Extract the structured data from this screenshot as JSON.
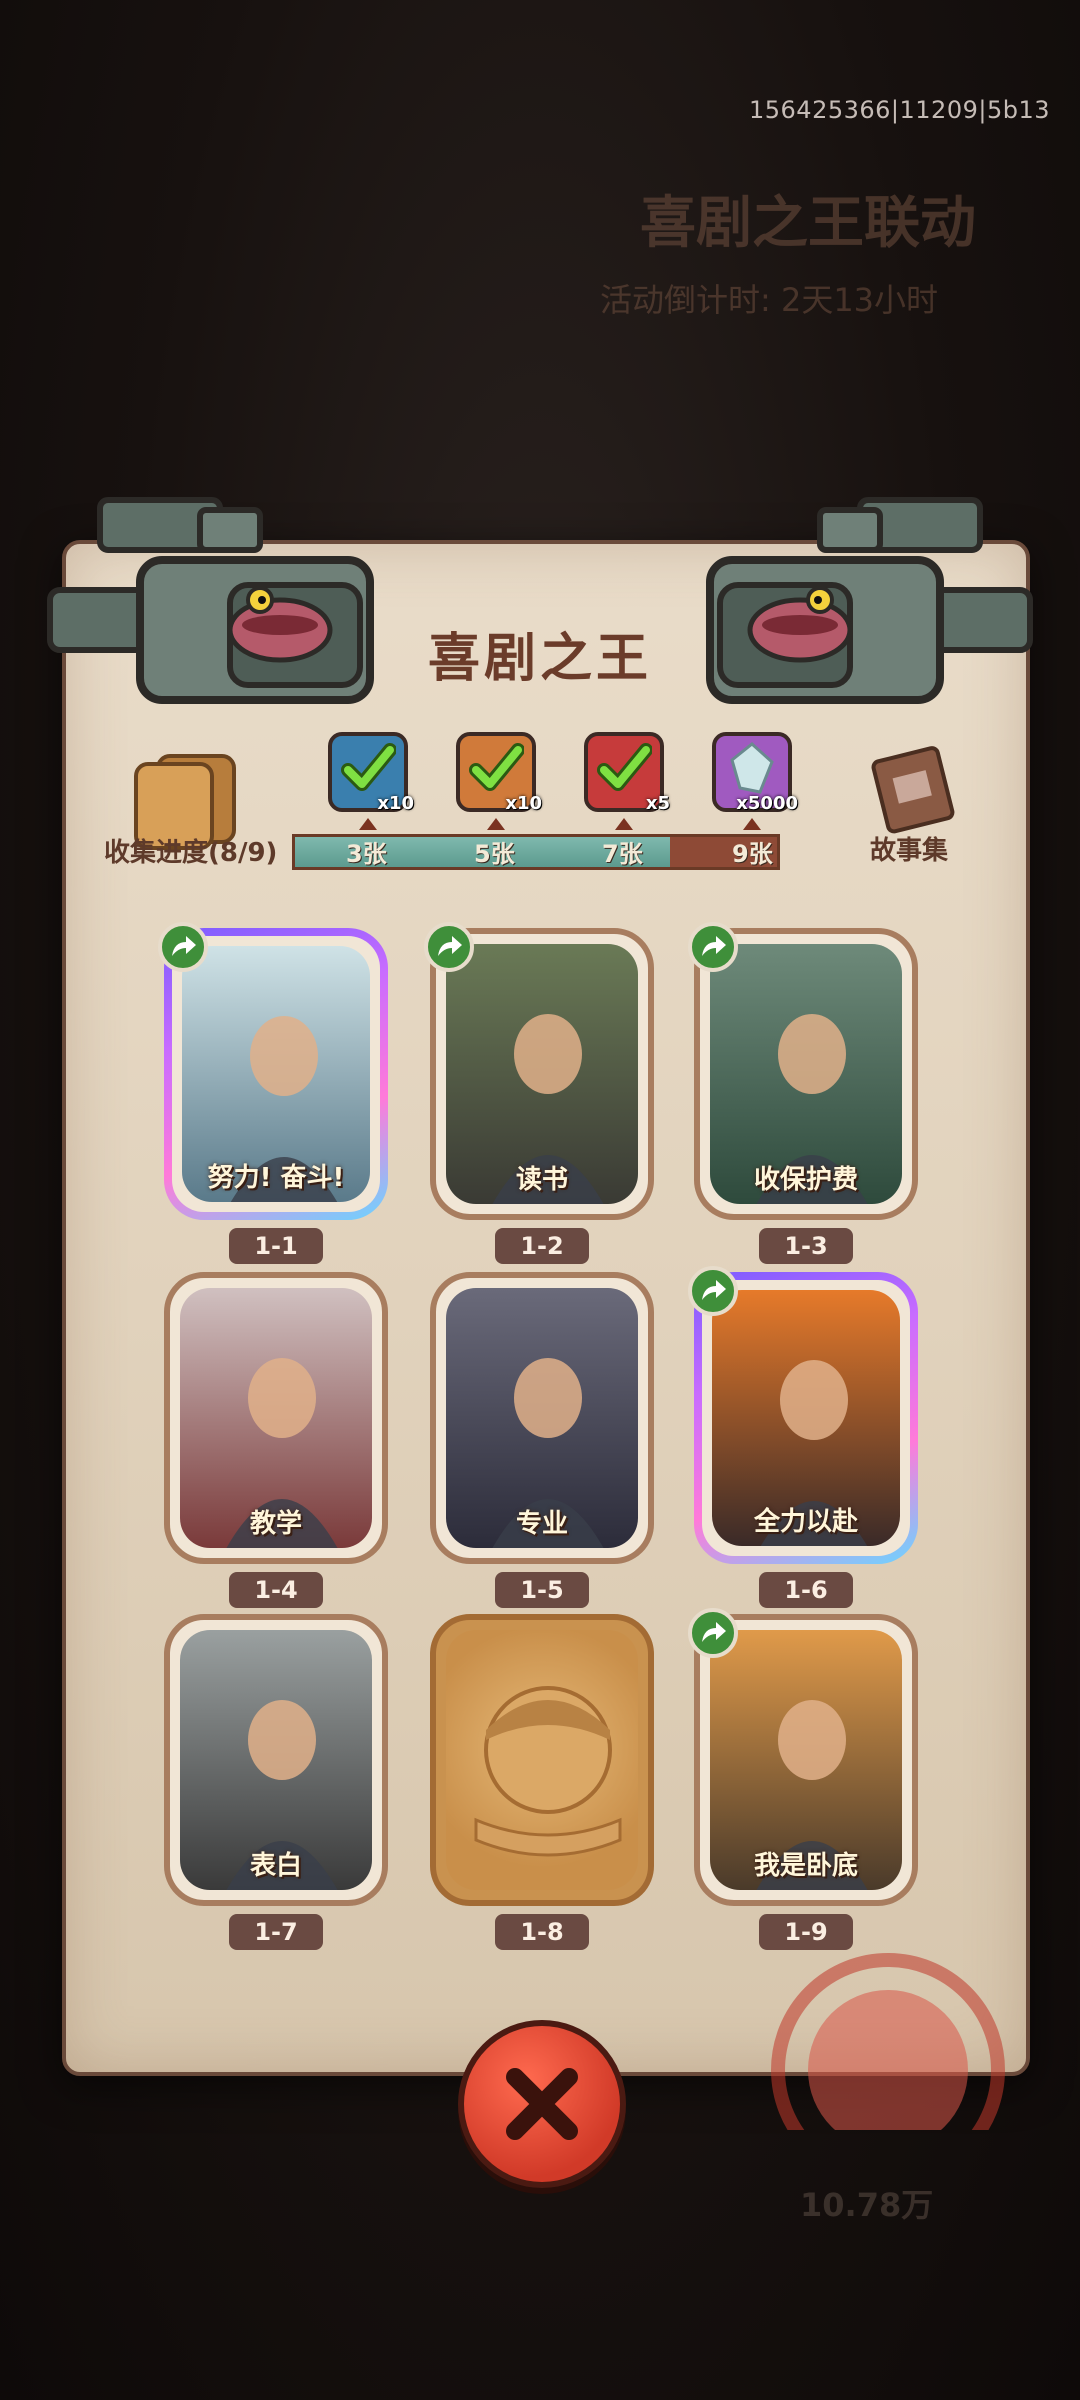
{
  "build_id": "156425366|11209|5b13",
  "background": {
    "event_subtitle": "",
    "event_title": "喜剧之王联动",
    "countdown": "活动倒计时: 2天13小时",
    "currency": "10.78万"
  },
  "panel": {
    "title": "喜剧之王",
    "collect_progress": "收集进度(8/9)",
    "story_label": "故事集"
  },
  "rewards": [
    {
      "multiplier": "x10",
      "icon": "teal-checked-chest-icon",
      "color": "#3a7fae"
    },
    {
      "multiplier": "x10",
      "icon": "orange-checked-chest-icon",
      "color": "#d07a3a"
    },
    {
      "multiplier": "x5",
      "icon": "red-checked-orb-icon",
      "color": "#c63b3b"
    },
    {
      "multiplier": "x5000",
      "icon": "purple-crystal-icon",
      "color": "#a05ac0"
    }
  ],
  "progress": {
    "milestones": [
      "3张",
      "5张",
      "7张",
      "9张"
    ],
    "collected": 8,
    "total": 9
  },
  "cards": [
    {
      "num": "1-1",
      "name": "努力! 奋斗!",
      "rare": true,
      "share": true,
      "locked": false
    },
    {
      "num": "1-2",
      "name": "读书",
      "rare": false,
      "share": true,
      "locked": false
    },
    {
      "num": "1-3",
      "name": "收保护费",
      "rare": false,
      "share": true,
      "locked": false
    },
    {
      "num": "1-4",
      "name": "教学",
      "rare": false,
      "share": false,
      "locked": false
    },
    {
      "num": "1-5",
      "name": "专业",
      "rare": false,
      "share": false,
      "locked": false
    },
    {
      "num": "1-6",
      "name": "全力以赴",
      "rare": true,
      "share": true,
      "locked": false
    },
    {
      "num": "1-7",
      "name": "表白",
      "rare": false,
      "share": false,
      "locked": false
    },
    {
      "num": "1-8",
      "name": "",
      "rare": false,
      "share": false,
      "locked": true
    },
    {
      "num": "1-9",
      "name": "我是卧底",
      "rare": false,
      "share": true,
      "locked": false
    }
  ],
  "stamp_text": "喜剧之王"
}
